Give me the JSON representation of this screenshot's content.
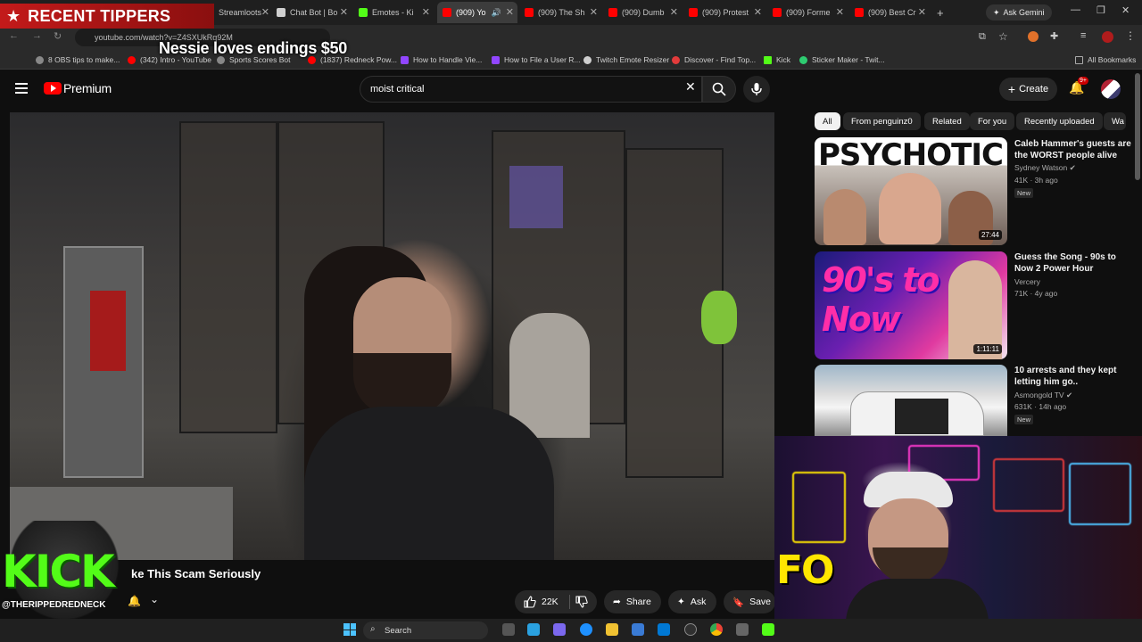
{
  "browser": {
    "tabs": [
      {
        "label": "Streamloots",
        "color": "#e23b3b"
      },
      {
        "label": "Chat Bot | Bo",
        "color": "#cfcfcf"
      },
      {
        "label": "Emotes - Ki",
        "color": "#53fc18"
      },
      {
        "label": "(909) Yo",
        "color": "#ff0000",
        "active": true
      },
      {
        "label": "(909) The Sh",
        "color": "#ff0000"
      },
      {
        "label": "(909) Dumb",
        "color": "#ff0000"
      },
      {
        "label": "(909) Protest",
        "color": "#ff0000"
      },
      {
        "label": "(909) Forme",
        "color": "#ff0000"
      },
      {
        "label": "(909) Best Cr",
        "color": "#ff0000"
      }
    ],
    "new_tab": "+",
    "ask_gemini": "Ask Gemini",
    "url": "youtube.com/watch?v=Z4SXUkRq92M",
    "bookmarks": [
      {
        "label": "8 OBS tips to make...",
        "color": "#888"
      },
      {
        "label": "(342) Intro - YouTube",
        "color": "#ff0000"
      },
      {
        "label": "Sports Scores Bot",
        "color": "#888"
      },
      {
        "label": "(1837) Redneck Pow...",
        "color": "#ff0000"
      },
      {
        "label": "How to Handle Vie...",
        "color": "#9146ff"
      },
      {
        "label": "How to File a User R...",
        "color": "#9146ff"
      },
      {
        "label": "Twitch Emote Resizer",
        "color": "#cfcfcf"
      },
      {
        "label": "Discover - Find Top...",
        "color": "#e23b3b"
      },
      {
        "label": "Kick",
        "color": "#53fc18"
      },
      {
        "label": "Sticker Maker - Twit...",
        "color": "#2ecc71"
      }
    ],
    "all_bookmarks": "All Bookmarks"
  },
  "overlay": {
    "recent_tippers": "RECENT TIPPERS",
    "tip_line": "Nessie loves endings $50",
    "kick_logo_text": "KICK",
    "kick_handle": "@THERIPPEDREDNECK",
    "webcam_sign": "FO"
  },
  "youtube": {
    "brand": "Premium",
    "search_value": "moist critical",
    "create_label": "Create",
    "notif_badge": "9+",
    "video_title": "ke This Scam Seriously",
    "like_count": "22K",
    "share_label": "Share",
    "ask_label": "Ask",
    "save_label": "Save",
    "chips": [
      "All",
      "From penguinz0",
      "Related",
      "For you",
      "Recently uploaded",
      "Wa"
    ],
    "recommendations": [
      {
        "title": "Caleb Hammer's guests are the WORST people alive",
        "channel": "Sydney Watson",
        "meta": "41K · 3h ago",
        "new": "New",
        "duration": "27:44",
        "thumb_text": "PSYCHOTIC"
      },
      {
        "title": "Guess the Song - 90s to Now 2 Power Hour",
        "channel": "Vercery",
        "meta": "71K · 4y ago",
        "new": "",
        "duration": "1:11:11",
        "thumb_text": "90's to Now"
      },
      {
        "title": "10 arrests and they kept letting him go..",
        "channel": "Asmongold TV",
        "meta": "631K · 14h ago",
        "new": "New",
        "duration": "",
        "thumb_text": ""
      }
    ]
  },
  "taskbar": {
    "search_label": "Search"
  },
  "icons": [
    "star-icon",
    "menu-icon",
    "search-icon",
    "mic-icon",
    "bell-icon",
    "plus-icon",
    "like-icon",
    "dislike-icon",
    "share-icon",
    "sparkle-icon",
    "save-icon",
    "verified-icon",
    "windows-icon"
  ]
}
